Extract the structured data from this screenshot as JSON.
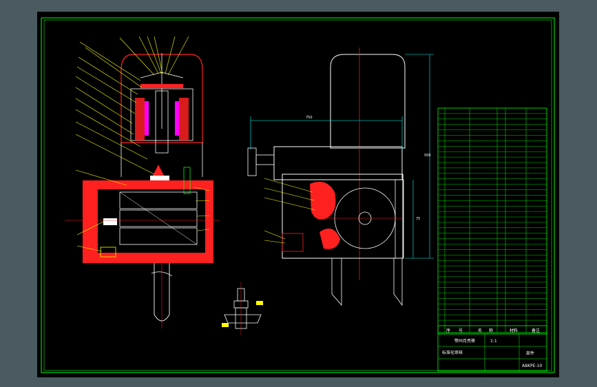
{
  "title_block": {
    "drawing_name": "鄂州月亮蒂",
    "scale": "1:1",
    "sheet_code": "ABKPE-10",
    "part_label": "部件",
    "hint_line": "标准化审核"
  },
  "parts_table": {
    "header": [
      "序",
      "号",
      "名",
      "称",
      "材料",
      "备注"
    ],
    "rows_count_hint": "40"
  },
  "dimensions": {
    "overall_width": "750",
    "height": "500",
    "side": "75"
  },
  "colors": {
    "frame": "#00ff00",
    "section": "#ff2020",
    "outline": "#ffffff",
    "dimension": "#00ffff",
    "leader": "#ffff00",
    "accent": "#ff00ff"
  }
}
